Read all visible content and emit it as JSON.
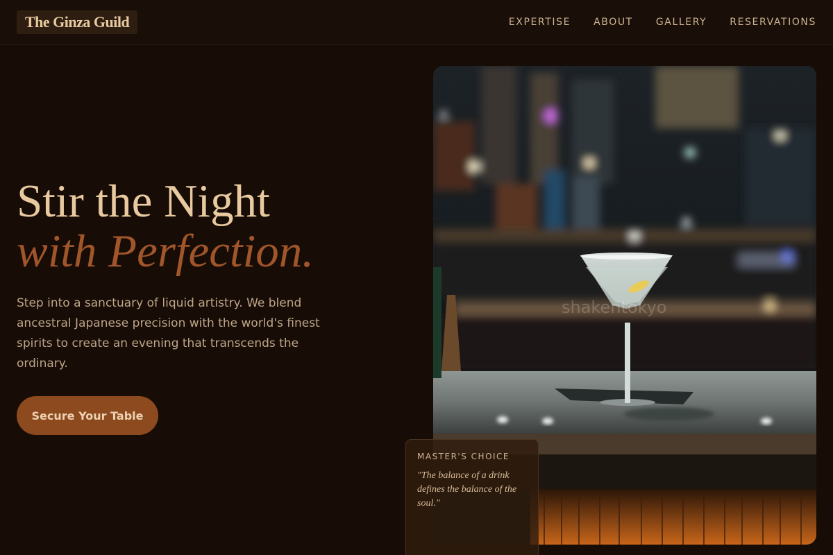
{
  "brand": {
    "logo_text": "The Ginza Guild"
  },
  "nav": {
    "items": [
      {
        "label": "EXPERTISE"
      },
      {
        "label": "ABOUT"
      },
      {
        "label": "GALLERY"
      },
      {
        "label": "RESERVATIONS"
      }
    ]
  },
  "hero": {
    "title_line1": "Stir the Night",
    "title_line2": "with Perfection.",
    "body": "Step into a sanctuary of liquid artistry. We blend ancestral Japanese precision with the world's finest spirits to create an evening that transcends the ordinary.",
    "cta_label": "Secure Your Table"
  },
  "photo": {
    "watermark": "shakentokyo"
  },
  "masters_choice": {
    "label": "MASTER'S CHOICE",
    "quote": "\"The balance of a drink defines the balance of the soul.\""
  },
  "colors": {
    "background": "#170d06",
    "accent": "#8d4a1e",
    "headline": "#e8c9a0",
    "headline_italic": "#a0552a"
  }
}
